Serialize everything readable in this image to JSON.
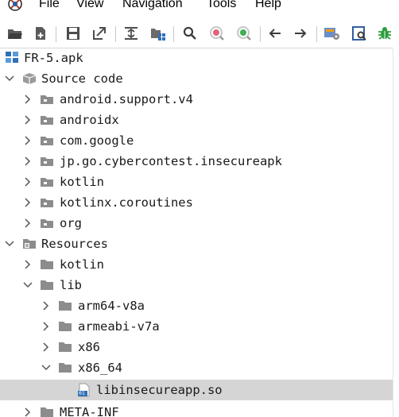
{
  "menubar": {
    "items": [
      "File",
      "View",
      "Navigation",
      "Tools",
      "Help"
    ]
  },
  "toolbar": {
    "buttons": [
      "open-folder-icon",
      "add-file-icon",
      "save-icon",
      "export-icon",
      "sync-icon",
      "flatten-packages-icon",
      "search-icon",
      "find-class-icon",
      "find-usage-icon",
      "back-icon",
      "forward-icon",
      "deobfuscation-icon",
      "log-viewer-icon",
      "debugger-icon"
    ]
  },
  "tree": {
    "root": "FR-5.apk",
    "source_code": "Source code",
    "packages": [
      "android.support.v4",
      "androidx",
      "com.google",
      "jp.go.cybercontest.insecureapk",
      "kotlin",
      "kotlinx.coroutines",
      "org"
    ],
    "resources": "Resources",
    "res_kotlin": "kotlin",
    "res_lib": "lib",
    "lib_dirs": [
      "arm64-v8a",
      "armeabi-v7a",
      "x86",
      "x86_64"
    ],
    "so_file": "libinsecureapp.so",
    "so_badge": "01",
    "meta_inf": "META-INF"
  },
  "colors": {
    "selection": "#d5d5d5",
    "folder": "#8c8c8c",
    "debug_green": "#2e9d3e",
    "badge_blue": "#2f6fb7"
  }
}
